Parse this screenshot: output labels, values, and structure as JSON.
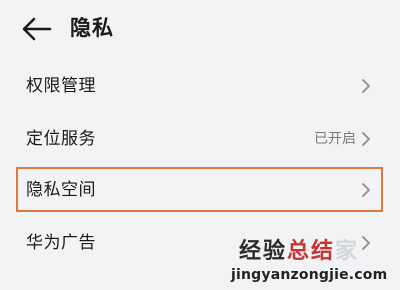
{
  "header": {
    "back_icon": "arrow-left-icon",
    "title": "隐私"
  },
  "settings": [
    {
      "label": "权限管理",
      "value": "",
      "chevron_icon": "chevron-right-icon"
    },
    {
      "label": "定位服务",
      "value": "已开启",
      "chevron_icon": "chevron-right-icon"
    },
    {
      "label": "隐私空间",
      "value": "",
      "chevron_icon": "chevron-right-icon",
      "highlighted": true
    },
    {
      "label": "华为广告",
      "value": "",
      "chevron_icon": "chevron-right-icon"
    }
  ],
  "watermark": {
    "part1": "经验",
    "part2": "总结",
    "part3": "家",
    "url": "jingyanzongjie.com"
  },
  "colors": {
    "background": "#f1f3f5",
    "highlight_border": "#e07a3d",
    "text_primary": "#1a1a1a",
    "text_secondary": "#7a7a7a",
    "chevron": "#8c8c8c",
    "watermark_red": "#c8342f"
  }
}
